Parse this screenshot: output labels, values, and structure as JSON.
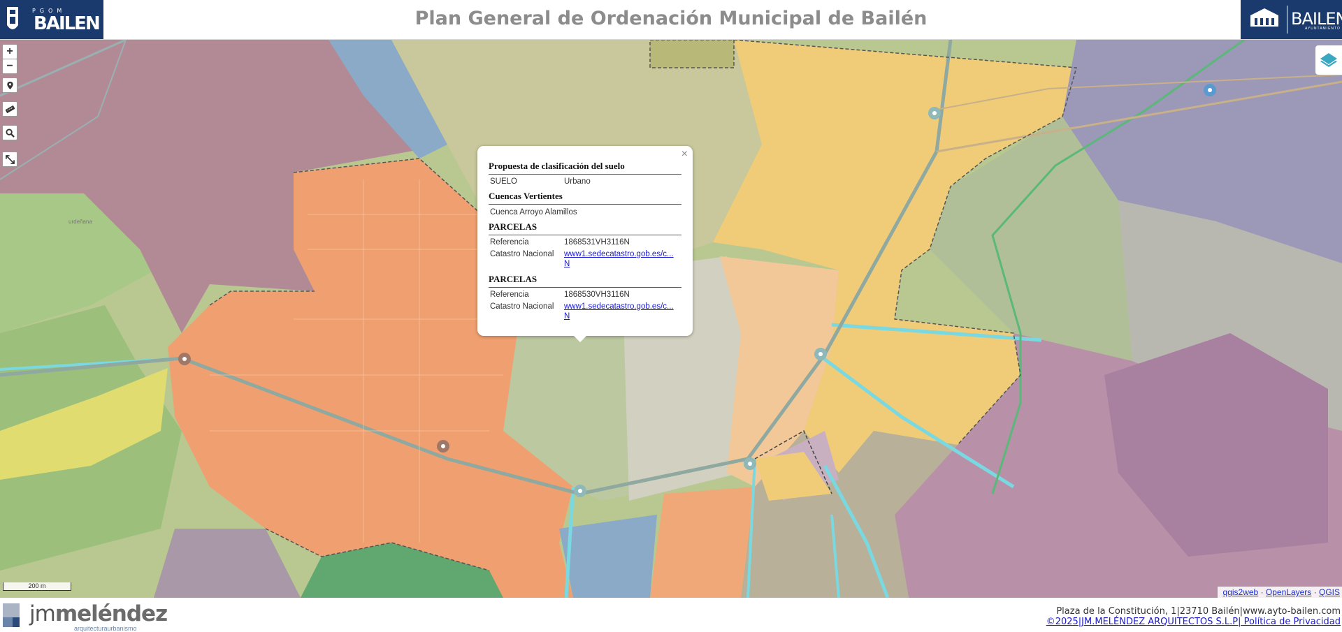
{
  "header": {
    "title": "Plan General de Ordenación Municipal de Bailén",
    "left_logo": {
      "top_text": "PGOM",
      "town": "BAILEN"
    },
    "right_logo": {
      "town": "BAILEN",
      "subtitle": "AYUNTAMIENTO"
    }
  },
  "map_controls": {
    "zoom_in": "+",
    "zoom_out": "−",
    "icons": [
      "geolocate-icon",
      "measure-icon",
      "search-icon",
      "fullscreen-icon"
    ],
    "layers_icon": "layers-icon"
  },
  "scale_bar": {
    "label": "200 m"
  },
  "attribution": {
    "items": [
      "qgis2web",
      "OpenLayers",
      "QGIS"
    ],
    "separator": "·"
  },
  "popup": {
    "close": "×",
    "section1": {
      "title": "Propuesta de clasificación del suelo",
      "rows": [
        {
          "key": "SUELO",
          "value": "Urbano"
        }
      ]
    },
    "section2": {
      "title": "Cuencas Vertientes",
      "value": "Cuenca Arroyo Alamillos"
    },
    "parcel1": {
      "title": "PARCELAS",
      "ref_key": "Referencia",
      "ref_value": "1868531VH3116N",
      "cat_key": "Catastro Nacional",
      "cat_link": "www1.sedecatastro.gob.es/c...",
      "cat_link2": "N"
    },
    "parcel2": {
      "title": "PARCELAS",
      "ref_key": "Referencia",
      "ref_value": "1868530VH3116N",
      "cat_key": "Catastro Nacional",
      "cat_link": "www1.sedecatastro.gob.es/c...",
      "cat_link2": "N"
    }
  },
  "map_labels": {
    "place": "urdeñana"
  },
  "footer": {
    "logo_name_light": "jm",
    "logo_name_bold": "meléndez",
    "logo_tag": "arquitecturaurbanismo",
    "address": "Plaza de la Constitución, 1|23710 Bailén|www.ayto-bailen.com",
    "copyright": "©2025|JM.MELÉNDEZ ARQUITECTOS S.L.P| Política de Privacidad"
  },
  "colors": {
    "header_blue": "#1a3a6e",
    "urban_orange": "#f0a070",
    "yellow_zone": "#f0d070",
    "purple_zone": "#b08aa8",
    "green_zone": "#a8c888",
    "blue_zone": "#8aaac8",
    "river_cyan": "#7ad8e0"
  }
}
